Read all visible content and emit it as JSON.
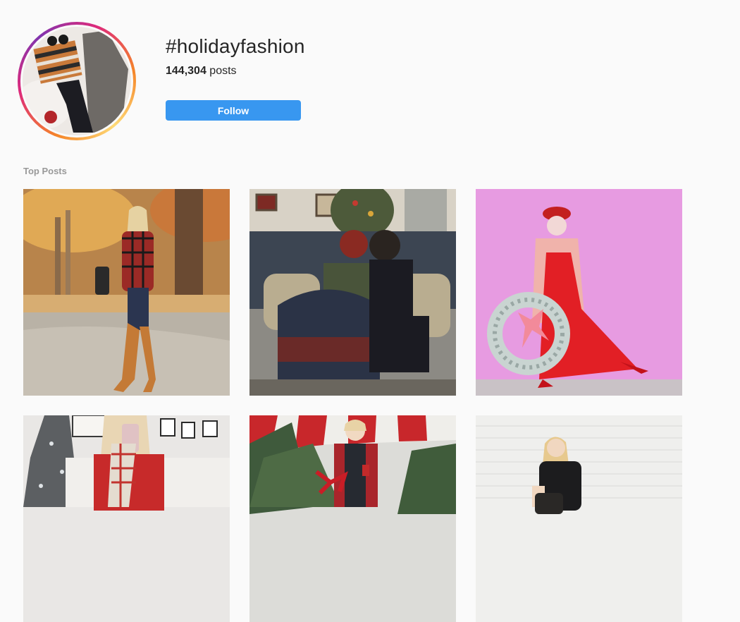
{
  "header": {
    "hashtag": "#holidayfashion",
    "post_count": "144,304",
    "post_count_suffix": " posts",
    "follow_label": "Follow"
  },
  "section": {
    "top_posts_label": "Top Posts"
  },
  "posts": [
    {
      "description_icon": "photo-autumn-plaid"
    },
    {
      "description_icon": "photo-christmas-couple"
    },
    {
      "description_icon": "photo-red-dress-wreath"
    },
    {
      "description_icon": "photo-selfie-christmas-tree"
    },
    {
      "description_icon": "photo-tree-lot"
    },
    {
      "description_icon": "photo-white-brick"
    }
  ],
  "colors": {
    "background": "#fafafa",
    "follow_button": "#3897f0",
    "section_label": "#999999"
  }
}
